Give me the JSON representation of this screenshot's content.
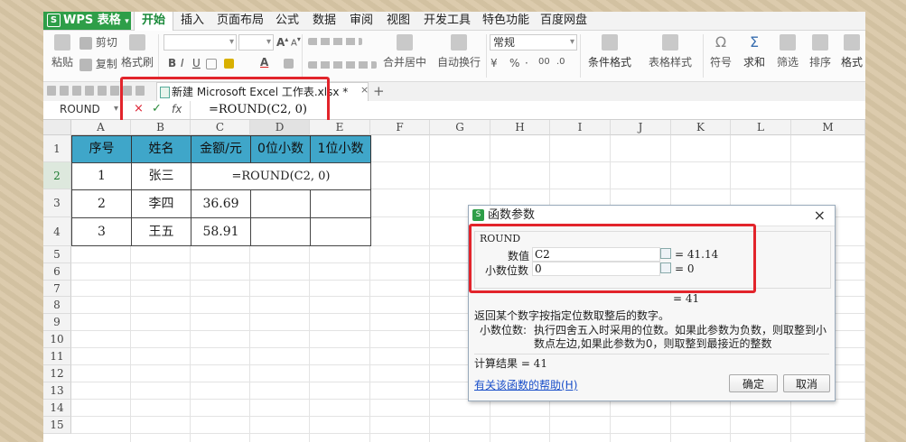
{
  "app": {
    "logo_glyph": "S",
    "logo_text": "WPS 表格",
    "logo_arrow": "▾"
  },
  "menu": [
    "开始",
    "插入",
    "页面布局",
    "公式",
    "数据",
    "审阅",
    "视图",
    "开发工具",
    "特色功能",
    "百度网盘"
  ],
  "ribbon": {
    "paste": "粘贴",
    "cut": "剪切",
    "copy": "复制",
    "format_painter": "格式刷",
    "bold": "B",
    "italic": "I",
    "underline": "U",
    "font_size_up": "A",
    "font_size_down": "A",
    "merge_center": "合并居中",
    "wrap_text": "自动换行",
    "number_format": "常规",
    "currency": "¥",
    "percent": "%",
    "comma": "·",
    "dec_inc": "00",
    "dec_dec": ".0",
    "conditional_format": "条件格式",
    "table_style": "表格样式",
    "symbol": "符号",
    "sum": "求和",
    "filter": "筛选",
    "sort": "排序",
    "format": "格式"
  },
  "doc_tab": {
    "label": "新建 Microsoft Excel 工作表.xlsx *",
    "close": "×",
    "add": "+"
  },
  "formula_bar": {
    "name_box": "ROUND",
    "cancel": "×",
    "confirm": "✓",
    "fx": "fx",
    "formula": "=ROUND(C2, 0)"
  },
  "columns": [
    "A",
    "B",
    "C",
    "D",
    "E",
    "F",
    "G",
    "H",
    "I",
    "J",
    "K",
    "L",
    "M"
  ],
  "rows": [
    "1",
    "2",
    "3",
    "4",
    "5",
    "6",
    "7",
    "8",
    "9",
    "10",
    "11",
    "12",
    "13",
    "14",
    "15"
  ],
  "table": {
    "headers": [
      "序号",
      "姓名",
      "金额/元",
      "0位小数",
      "1位小数"
    ],
    "row2": {
      "a": "1",
      "b": "张三",
      "edit": "=ROUND(C2, 0)"
    },
    "row3": {
      "a": "2",
      "b": "李四",
      "c": "36.69"
    },
    "row4": {
      "a": "3",
      "b": "王五",
      "c": "58.91"
    }
  },
  "dialog": {
    "logo_glyph": "S",
    "title": "函数参数",
    "close": "×",
    "function_name": "ROUND",
    "arg1_label": "数值",
    "arg1_value": "C2",
    "arg1_result": "= 41.14",
    "arg2_label": "小数位数",
    "arg2_value": "0",
    "arg2_result": "= 0",
    "result_preview": "= 41",
    "description": "返回某个数字按指定位数取整后的数字。",
    "param_name": "小数位数:",
    "param_desc_1": "执行四舍五入时采用的位数。如果此参数为负数，则取整到小",
    "param_desc_2": "数点左边,如果此参数为0，则取整到最接近的整数",
    "calc_result": "计算结果 = 41",
    "help_link": "有关该函数的帮助(H)",
    "ok": "确定",
    "cancel": "取消"
  },
  "colors": {
    "accent": "#2e9e48",
    "header_fill": "#3fa6c9",
    "highlight_box": "#e2242b",
    "link": "#1a4fc9"
  }
}
